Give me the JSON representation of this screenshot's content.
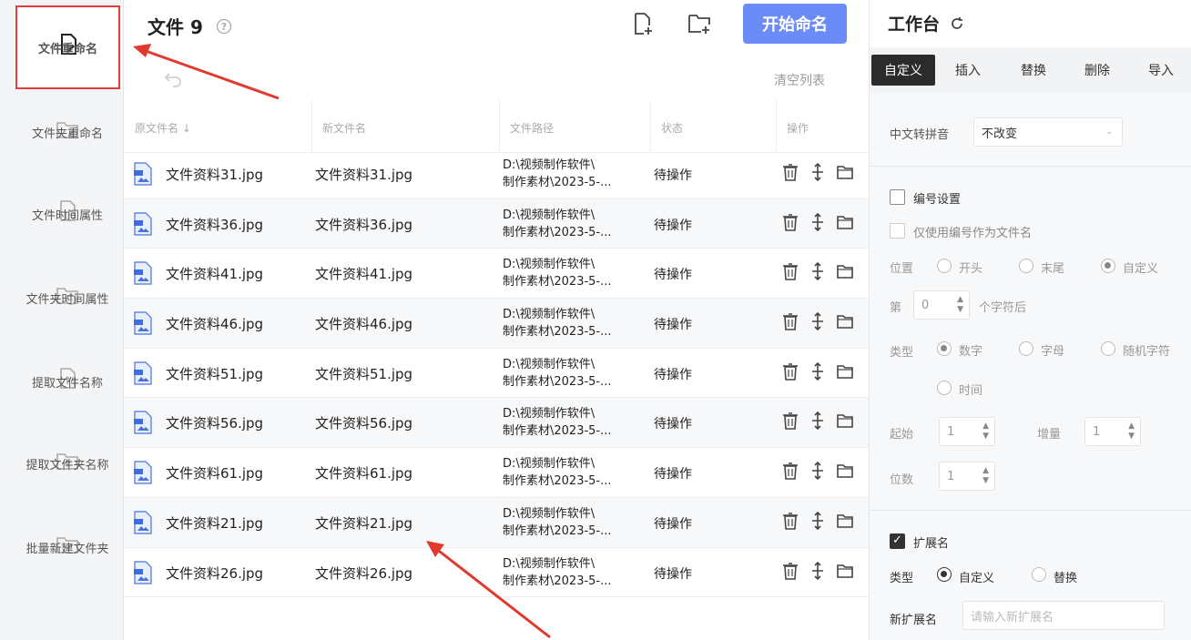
{
  "sidebar": {
    "items": [
      {
        "label": "文件重命名",
        "icon": "file-edit-icon"
      },
      {
        "label": "文件夹重命名",
        "icon": "folder-edit-icon"
      },
      {
        "label": "文件时间属性",
        "icon": "file-clock-icon"
      },
      {
        "label": "文件夹时间属性",
        "icon": "folder-clock-icon"
      },
      {
        "label": "提取文件名称",
        "icon": "file-upload-icon"
      },
      {
        "label": "提取文件夹名称",
        "icon": "folder-upload-icon"
      },
      {
        "label": "批量新建文件夹",
        "icon": "folder-new-icon"
      }
    ]
  },
  "header": {
    "title": "文件",
    "count": "9",
    "start_button": "开始命名",
    "clear_list": "清空列表"
  },
  "table": {
    "columns": [
      "原文件名 ↓",
      "新文件名",
      "文件路径",
      "状态",
      "操作"
    ],
    "rows": [
      {
        "orig": "文件资料31.jpg",
        "new": "文件资料31.jpg",
        "path": "D:\\视频制作软件\\\n制作素材\\2023-5-...",
        "status": "待操作"
      },
      {
        "orig": "文件资料36.jpg",
        "new": "文件资料36.jpg",
        "path": "D:\\视频制作软件\\\n制作素材\\2023-5-...",
        "status": "待操作"
      },
      {
        "orig": "文件资料41.jpg",
        "new": "文件资料41.jpg",
        "path": "D:\\视频制作软件\\\n制作素材\\2023-5-...",
        "status": "待操作"
      },
      {
        "orig": "文件资料46.jpg",
        "new": "文件资料46.jpg",
        "path": "D:\\视频制作软件\\\n制作素材\\2023-5-...",
        "status": "待操作"
      },
      {
        "orig": "文件资料51.jpg",
        "new": "文件资料51.jpg",
        "path": "D:\\视频制作软件\\\n制作素材\\2023-5-...",
        "status": "待操作"
      },
      {
        "orig": "文件资料56.jpg",
        "new": "文件资料56.jpg",
        "path": "D:\\视频制作软件\\\n制作素材\\2023-5-...",
        "status": "待操作"
      },
      {
        "orig": "文件资料61.jpg",
        "new": "文件资料61.jpg",
        "path": "D:\\视频制作软件\\\n制作素材\\2023-5-...",
        "status": "待操作"
      },
      {
        "orig": "文件资料21.jpg",
        "new": "文件资料21.jpg",
        "path": "D:\\视频制作软件\\\n制作素材\\2023-5-...",
        "status": "待操作"
      },
      {
        "orig": "文件资料26.jpg",
        "new": "文件资料26.jpg",
        "path": "D:\\视频制作软件\\\n制作素材\\2023-5-...",
        "status": "待操作"
      }
    ]
  },
  "panel": {
    "title": "工作台",
    "tabs": [
      "自定义",
      "插入",
      "替换",
      "删除",
      "导入"
    ],
    "pinyin_label": "中文转拼音",
    "pinyin_value": "不改变",
    "numbering_label": "编号设置",
    "only_number_label": "仅使用编号作为文件名",
    "position_label": "位置",
    "position_options": [
      "开头",
      "末尾",
      "自定义"
    ],
    "nth_label": "第",
    "nth_value": "0",
    "nth_suffix": "个字符后",
    "type_label": "类型",
    "type_options": [
      "数字",
      "字母",
      "随机字符",
      "时间"
    ],
    "start_label": "起始",
    "start_value": "1",
    "step_label": "增量",
    "step_value": "1",
    "digits_label": "位数",
    "digits_value": "1",
    "ext_label": "扩展名",
    "ext_type_label": "类型",
    "ext_type_options": [
      "自定义",
      "替换"
    ],
    "new_ext_label": "新扩展名",
    "new_ext_placeholder": "请输入新扩展名"
  },
  "colors": {
    "accent": "#6b8cf7",
    "highlight_border": "#e23b3b",
    "arrow": "#e03a2f"
  }
}
